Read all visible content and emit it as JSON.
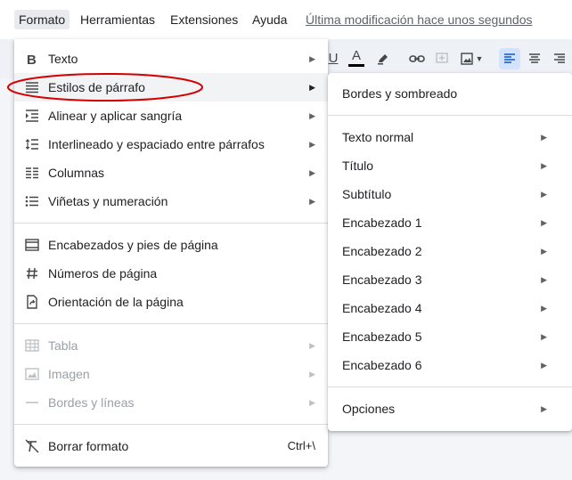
{
  "menubar": {
    "formato": "Formato",
    "herramientas": "Herramientas",
    "extensiones": "Extensiones",
    "ayuda": "Ayuda",
    "last_modified": "Última modificación hace unos segundos"
  },
  "toolbar": {
    "underline": "U",
    "text_color": "A",
    "icons": [
      "underline-icon",
      "text-color-icon",
      "highlighter-icon",
      "link-icon",
      "add-comment-icon",
      "insert-image-icon",
      "align-left-icon",
      "align-center-icon",
      "align-right-icon"
    ]
  },
  "format_menu": {
    "items": [
      {
        "label": "Texto",
        "icon": "bold-icon",
        "submenu": true
      },
      {
        "label": "Estilos de párrafo",
        "icon": "paragraph-styles-icon",
        "submenu": true,
        "highlighted": true
      },
      {
        "label": "Alinear y aplicar sangría",
        "icon": "indent-icon",
        "submenu": true
      },
      {
        "label": "Interlineado y espaciado entre párrafos",
        "icon": "line-spacing-icon",
        "submenu": true
      },
      {
        "label": "Columnas",
        "icon": "columns-icon",
        "submenu": true
      },
      {
        "label": "Viñetas y numeración",
        "icon": "bullet-list-icon",
        "submenu": true
      },
      {
        "label": "Encabezados y pies de página",
        "icon": "header-footer-icon"
      },
      {
        "label": "Números de página",
        "icon": "hash-icon"
      },
      {
        "label": "Orientación de la página",
        "icon": "page-orientation-icon"
      },
      {
        "label": "Tabla",
        "icon": "table-icon",
        "submenu": true,
        "disabled": true
      },
      {
        "label": "Imagen",
        "icon": "image-icon",
        "submenu": true,
        "disabled": true
      },
      {
        "label": "Bordes y líneas",
        "icon": "line-icon",
        "submenu": true,
        "disabled": true
      },
      {
        "label": "Borrar formato",
        "icon": "clear-format-icon",
        "shortcut": "Ctrl+\\"
      }
    ]
  },
  "styles_submenu": {
    "borders": "Bordes y sombreado",
    "items": [
      "Texto normal",
      "Título",
      "Subtítulo",
      "Encabezado 1",
      "Encabezado 2",
      "Encabezado 3",
      "Encabezado 4",
      "Encabezado 5",
      "Encabezado 6"
    ],
    "options": "Opciones"
  },
  "colors": {
    "annotation": "#d50000",
    "highlight": "#f1f3f4",
    "selected_tool": "#d3e3fd",
    "text_color_bar": "#000000"
  }
}
